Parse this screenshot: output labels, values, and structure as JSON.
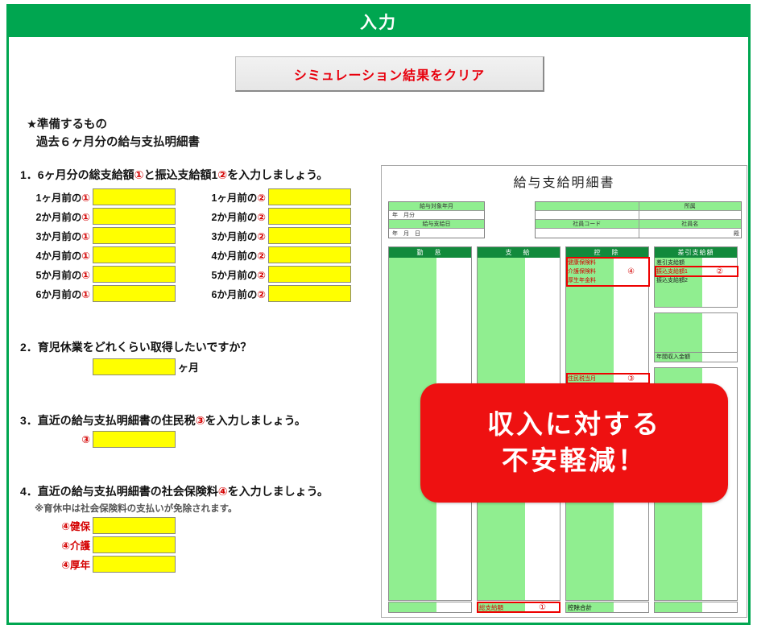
{
  "window": {
    "title": "入力"
  },
  "toolbar": {
    "clear_button": "シミュレーション結果をクリア"
  },
  "prepare": {
    "heading": "★準備するもの",
    "line2": "過去６ヶ月分の給与支払明細書"
  },
  "sections": {
    "s1": {
      "number": "1．",
      "text_a": "6ヶ月分の総支給額",
      "mark_a": "①",
      "text_b": "と振込支給額1",
      "mark_b": "②",
      "text_c": "を入力しましょう。",
      "left_rows": [
        {
          "label": "1ヶ月前の",
          "mark": "①",
          "value": ""
        },
        {
          "label": "2か月前の",
          "mark": "①",
          "value": ""
        },
        {
          "label": "3か月前の",
          "mark": "①",
          "value": ""
        },
        {
          "label": "4か月前の",
          "mark": "①",
          "value": ""
        },
        {
          "label": "5か月前の",
          "mark": "①",
          "value": ""
        },
        {
          "label": "6か月前の",
          "mark": "①",
          "value": ""
        }
      ],
      "right_rows": [
        {
          "label": "1ヶ月前の",
          "mark": "②",
          "value": ""
        },
        {
          "label": "2か月前の",
          "mark": "②",
          "value": ""
        },
        {
          "label": "3か月前の",
          "mark": "②",
          "value": ""
        },
        {
          "label": "4か月前の",
          "mark": "②",
          "value": ""
        },
        {
          "label": "5か月前の",
          "mark": "②",
          "value": ""
        },
        {
          "label": "6か月前の",
          "mark": "②",
          "value": ""
        }
      ]
    },
    "s2": {
      "number": "2．",
      "text": "育児休業をどれくらい取得したいですか？",
      "value": "",
      "suffix": "ヶ月"
    },
    "s3": {
      "number": "3．",
      "text_a": "直近の給与支払明細書の住民税",
      "mark": "③",
      "text_b": "を入力しましょう。",
      "field_label": "③",
      "value": ""
    },
    "s4": {
      "number": "4．",
      "text_a": "直近の給与支払明細書の社会保険料",
      "mark": "④",
      "text_b": "を入力しましょう。",
      "note": "※育休中は社会保険料の支払いが免除されます。",
      "rows": [
        {
          "label": "④健保",
          "value": ""
        },
        {
          "label": "④介護",
          "value": ""
        },
        {
          "label": "④厚年",
          "value": ""
        }
      ]
    }
  },
  "payslip": {
    "title": "給与支給明細書",
    "left_table": [
      {
        "head": "給与対象年月",
        "value": "年　月分"
      },
      {
        "head": "給与支給日",
        "value": "年　月　日"
      }
    ],
    "right_table": {
      "row1_head_left": "",
      "row1_head_right": "所属",
      "row1_val_left": "",
      "row1_val_right": "",
      "row2_head_left": "社員コード",
      "row2_head_right": "社員名",
      "row2_val_left": "",
      "row2_val_right": "殿"
    },
    "columns": [
      {
        "header": "勤　怠"
      },
      {
        "header": "支　給"
      },
      {
        "header": "控　除"
      },
      {
        "header": "差引支給額"
      }
    ],
    "deduction_items": [
      {
        "label": "健康保険料",
        "value": ""
      },
      {
        "label": "介護保険料",
        "value": "④"
      },
      {
        "label": "厚生年金料",
        "value": ""
      }
    ],
    "resident_tax": {
      "label": "住民税当月",
      "value": "③"
    },
    "net_items": [
      {
        "label": "差引支給額",
        "value": ""
      },
      {
        "label": "振込支給額1",
        "value": "②"
      },
      {
        "label": "振込支給額2",
        "value": ""
      }
    ],
    "annual_income_label": "年間収入金額",
    "total_paid": {
      "label": "総支給額",
      "value": "①"
    },
    "total_deduction": {
      "label": "控除合計",
      "value": ""
    }
  },
  "callout": {
    "line1": "収入に対する",
    "line2": "不安軽減！"
  },
  "colors": {
    "brand_green": "#00a650",
    "header_green": "#128a3c",
    "cell_green": "#90ee90",
    "input_yellow": "#ffff00",
    "accent_red": "#ee1111",
    "mark_red": "#d40000"
  }
}
